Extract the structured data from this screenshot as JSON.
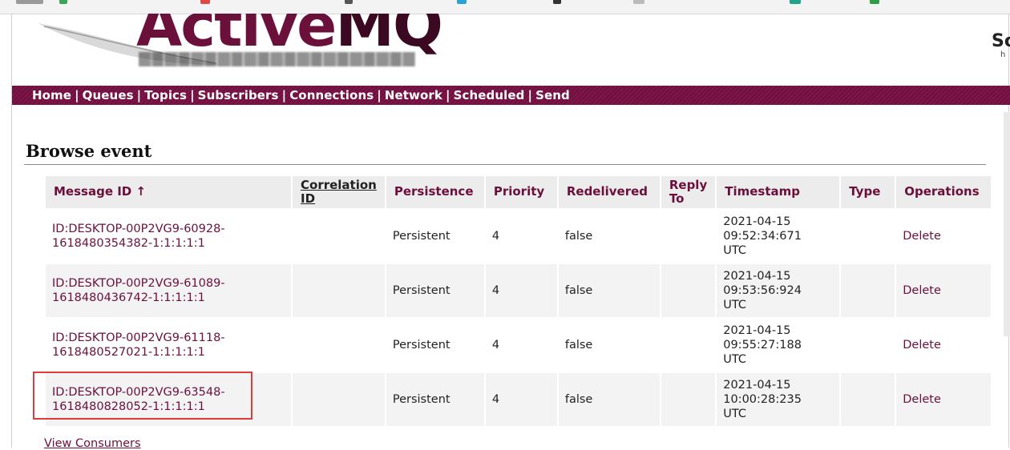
{
  "nav": {
    "home": "Home",
    "queues": "Queues",
    "topics": "Topics",
    "subscribers": "Subscribers",
    "connections": "Connections",
    "network": "Network",
    "scheduled": "Scheduled",
    "send": "Send",
    "separator": "|"
  },
  "header": {
    "logo_part1": "Active",
    "logo_part2": "MQ",
    "sponsor_text": "So",
    "sponsor_sub": "h"
  },
  "page": {
    "title": "Browse event",
    "footer_link": "View Consumers"
  },
  "table": {
    "columns": {
      "message_id": "Message ID ↑",
      "correlation_id": "Correlation ID",
      "persistence": "Persistence",
      "priority": "Priority",
      "redelivered": "Redelivered",
      "reply_to": "Reply To",
      "timestamp": "Timestamp",
      "type": "Type",
      "operations": "Operations"
    },
    "rows": [
      {
        "id_line1": "ID:DESKTOP-00P2VG9-60928-",
        "id_line2": "1618480354382-1:1:1:1:1",
        "correlation_id": "",
        "persistence": "Persistent",
        "priority": "4",
        "redelivered": "false",
        "reply_to": "",
        "ts_date": "2021-04-15",
        "ts_time": "09:52:34:671",
        "ts_zone": "UTC",
        "type": "",
        "action": "Delete"
      },
      {
        "id_line1": "ID:DESKTOP-00P2VG9-61089-",
        "id_line2": "1618480436742-1:1:1:1:1",
        "correlation_id": "",
        "persistence": "Persistent",
        "priority": "4",
        "redelivered": "false",
        "reply_to": "",
        "ts_date": "2021-04-15",
        "ts_time": "09:53:56:924",
        "ts_zone": "UTC",
        "type": "",
        "action": "Delete"
      },
      {
        "id_line1": "ID:DESKTOP-00P2VG9-61118-",
        "id_line2": "1618480527021-1:1:1:1:1",
        "correlation_id": "",
        "persistence": "Persistent",
        "priority": "4",
        "redelivered": "false",
        "reply_to": "",
        "ts_date": "2021-04-15",
        "ts_time": "09:55:27:188",
        "ts_zone": "UTC",
        "type": "",
        "action": "Delete"
      },
      {
        "id_line1": "ID:DESKTOP-00P2VG9-63548-",
        "id_line2": "1618480828052-1:1:1:1:1",
        "correlation_id": "",
        "persistence": "Persistent",
        "priority": "4",
        "redelivered": "false",
        "reply_to": "",
        "ts_date": "2021-04-15",
        "ts_time": "10:00:28:235",
        "ts_zone": "UTC",
        "type": "",
        "action": "Delete"
      }
    ]
  },
  "colors": {
    "brand": "#730d3f",
    "link": "#6b0f3b",
    "highlight_box": "#e03b3b",
    "header_cell_bg": "#ececec",
    "alt_row_bg": "#f3f3f3"
  }
}
